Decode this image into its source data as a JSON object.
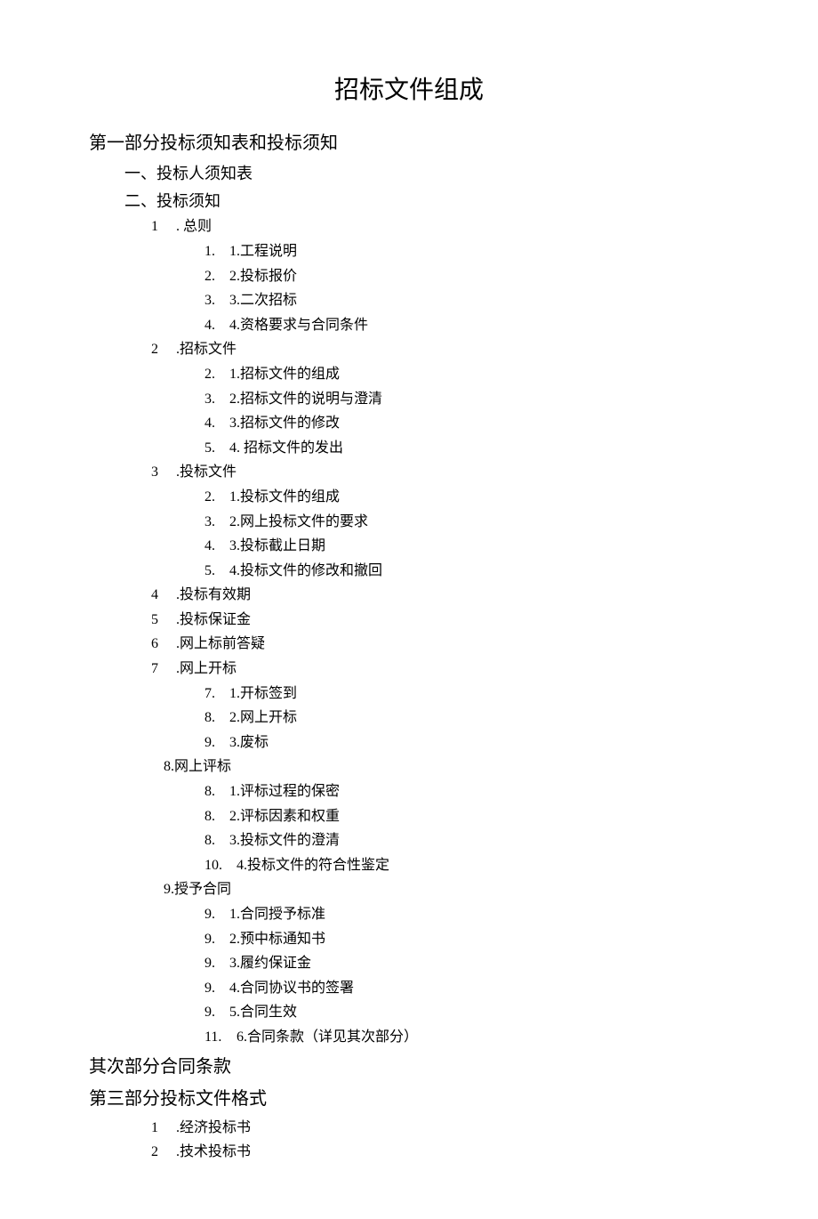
{
  "title": "招标文件组成",
  "part1": {
    "heading": "第一部分投标须知表和投标须知",
    "sec1": "一、投标人须知表",
    "sec2": "二、投标须知",
    "s1": {
      "num": "1",
      "sep": ". 总则",
      "i1n": "1.",
      "i1t": "1.工程说明",
      "i2n": "2.",
      "i2t": "2.投标报价",
      "i3n": "3.",
      "i3t": "3.二次招标",
      "i4n": "4.",
      "i4t": "4.资格要求与合同条件"
    },
    "s2": {
      "num": "2",
      "sep": ".招标文件",
      "i1n": "2.",
      "i1t": "1.招标文件的组成",
      "i2n": "3.",
      "i2t": "2.招标文件的说明与澄清",
      "i3n": "4.",
      "i3t": "3.招标文件的修改",
      "i4n": "5.",
      "i4t": "4. 招标文件的发出"
    },
    "s3": {
      "num": "3",
      "sep": ".投标文件",
      "i1n": "2.",
      "i1t": "1.投标文件的组成",
      "i2n": "3.",
      "i2t": "2.网上投标文件的要求",
      "i3n": "4.",
      "i3t": "3.投标截止日期",
      "i4n": "5.",
      "i4t": "4.投标文件的修改和撤回"
    },
    "s4": {
      "num": "4",
      "sep": ".投标有效期"
    },
    "s5": {
      "num": "5",
      "sep": ".投标保证金"
    },
    "s6": {
      "num": "6",
      "sep": ".网上标前答疑"
    },
    "s7": {
      "num": "7",
      "sep": ".网上开标",
      "i1n": "7.",
      "i1t": "1.开标签到",
      "i2n": "8.",
      "i2t": "2.网上开标",
      "i3n": "9.",
      "i3t": "3.废标"
    },
    "s8": {
      "heading": "8.网上评标",
      "i1n": "8.",
      "i1t": "1.评标过程的保密",
      "i2n": "8.",
      "i2t": "2.评标因素和权重",
      "i3n": "8.",
      "i3t": "3.投标文件的澄清",
      "i4n": "10.",
      "i4t": "4.投标文件的符合性鉴定"
    },
    "s9": {
      "heading": "9.授予合同",
      "i1n": "9.",
      "i1t": "1.合同授予标准",
      "i2n": "9.",
      "i2t": "2.预中标通知书",
      "i3n": "9.",
      "i3t": "3.履约保证金",
      "i4n": "9.",
      "i4t": "4.合同协议书的签署",
      "i5n": "9.",
      "i5t": "5.合同生效",
      "i6n": "11.",
      "i6t": "6.合同条款（详见其次部分）"
    }
  },
  "part2": {
    "heading": "其次部分合同条款"
  },
  "part3": {
    "heading": "第三部分投标文件格式",
    "i1n": "1",
    "i1t": ".经济投标书",
    "i2n": "2",
    "i2t": ".技术投标书"
  }
}
